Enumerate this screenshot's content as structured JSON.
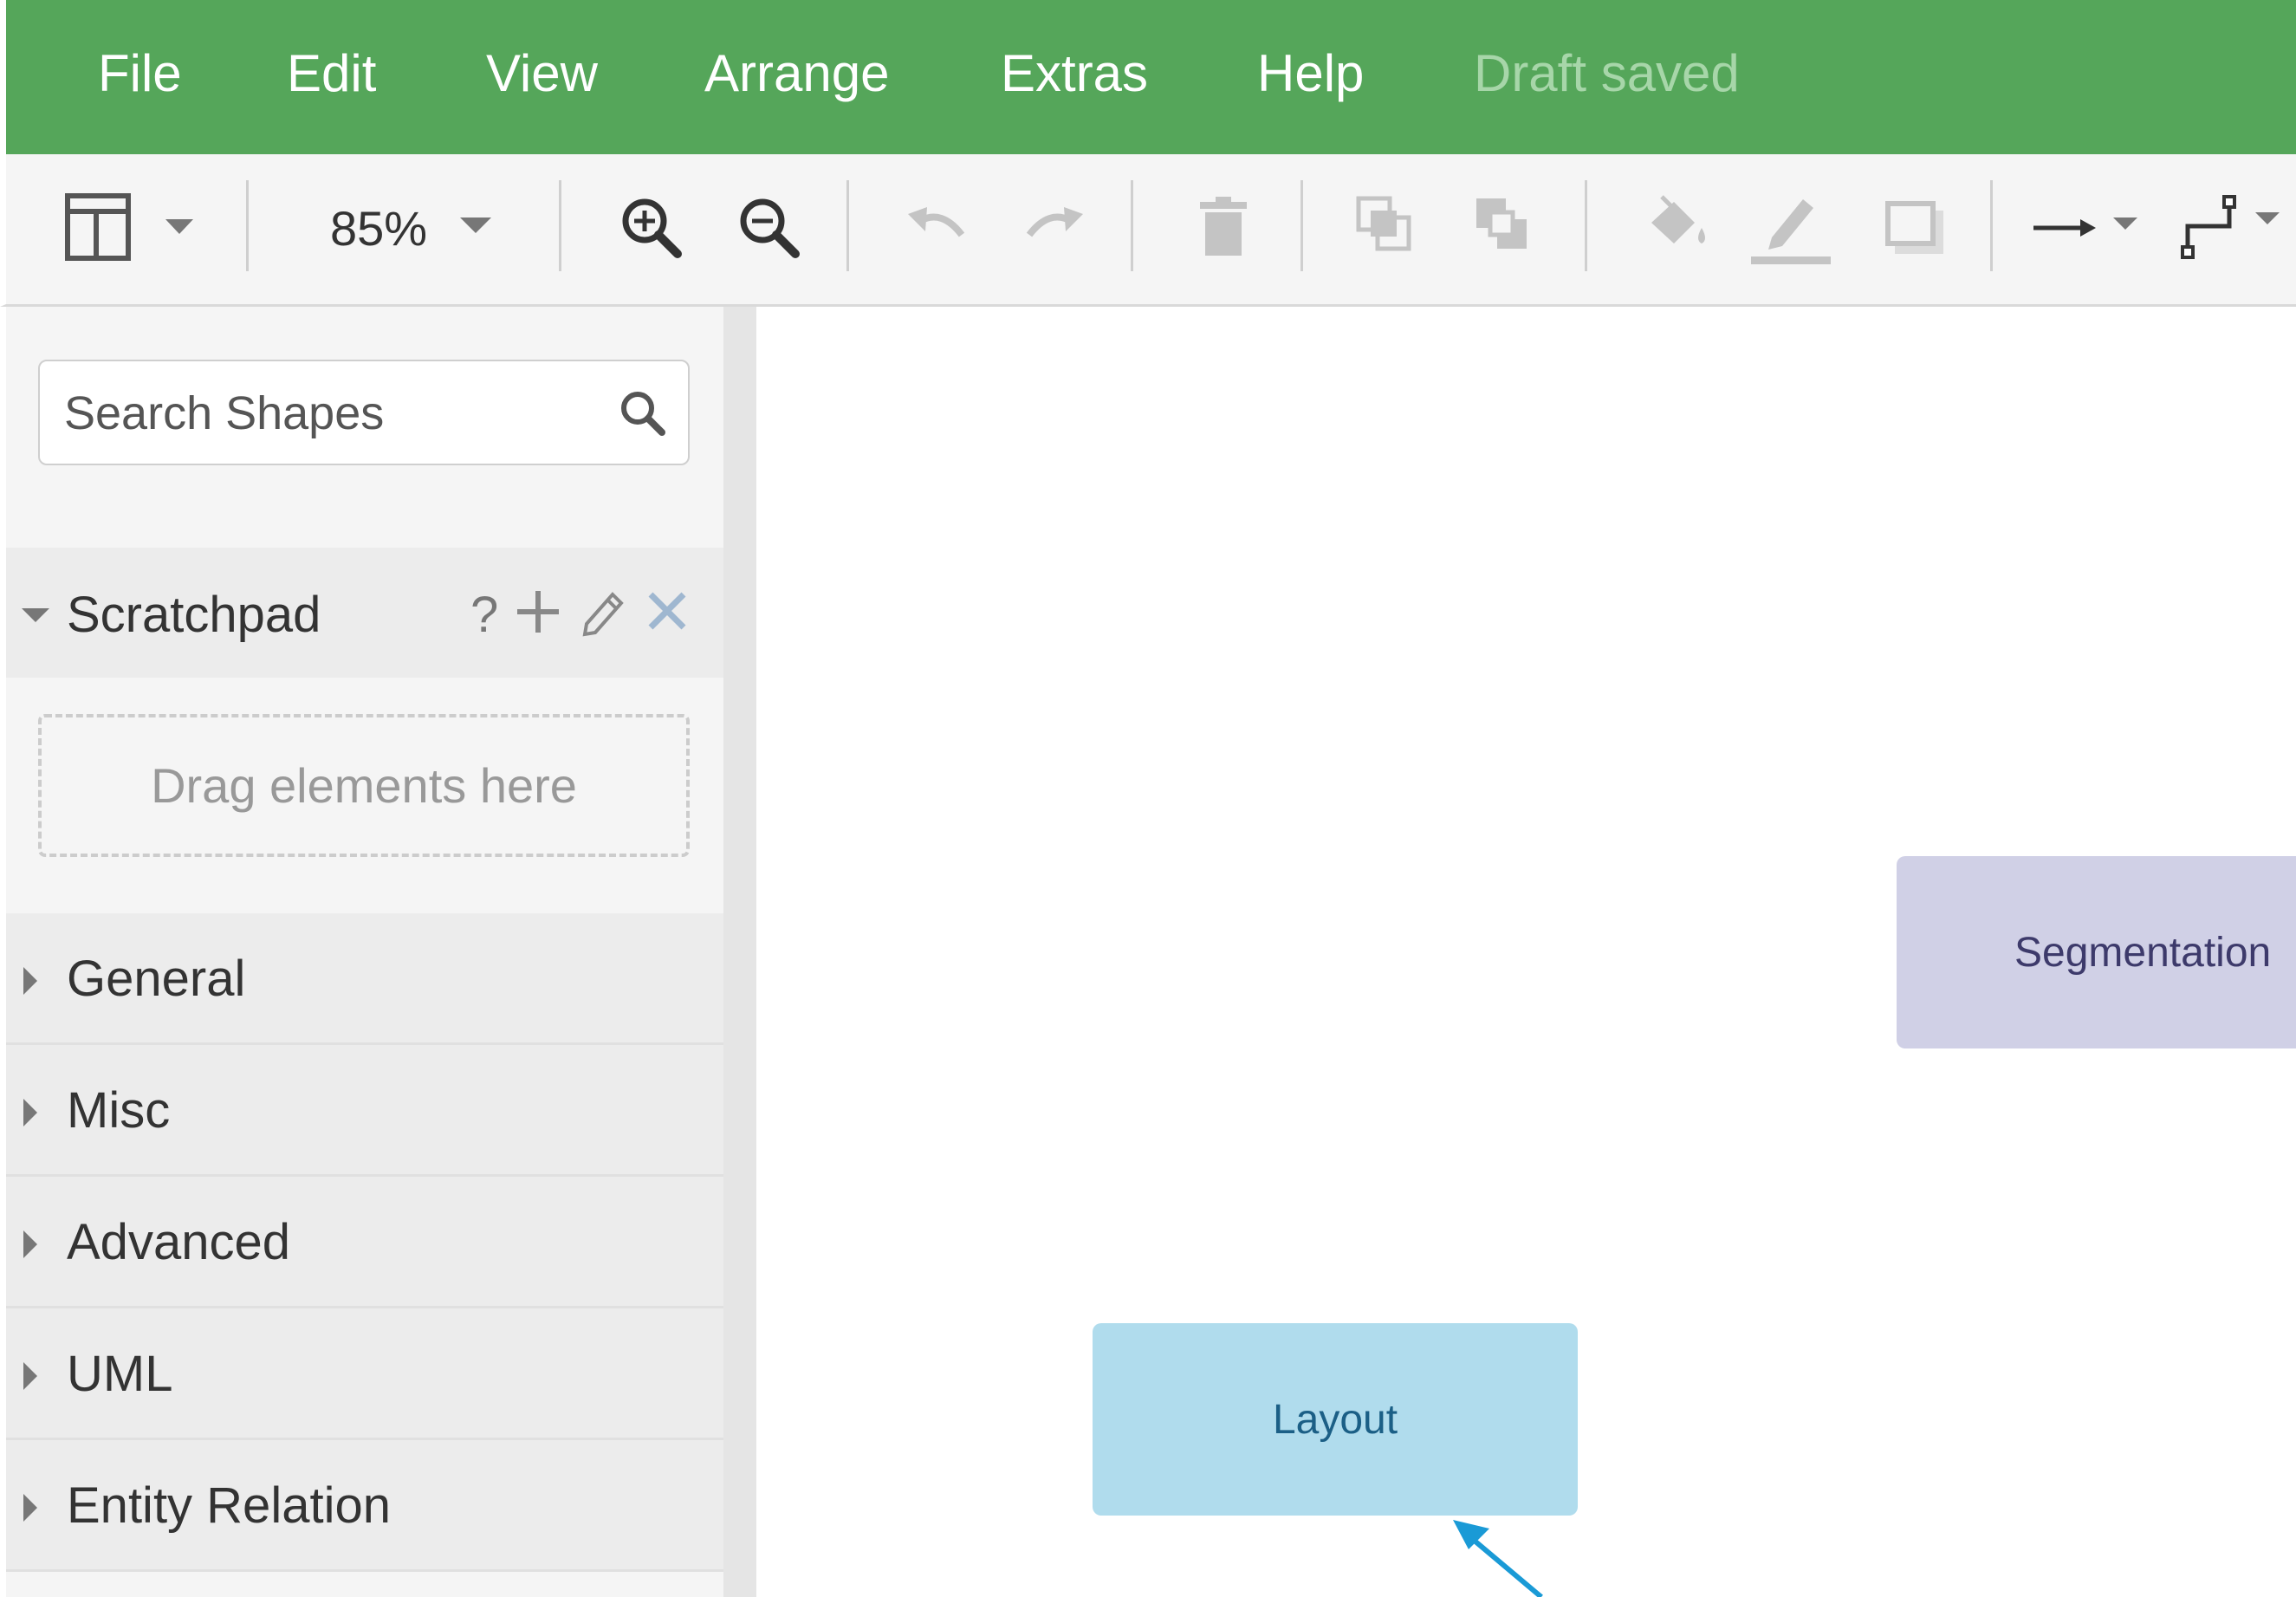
{
  "menubar": {
    "items": [
      "File",
      "Edit",
      "View",
      "Arrange",
      "Extras",
      "Help"
    ],
    "status": "Draft saved",
    "color": "#55a65a"
  },
  "toolbar": {
    "zoom": "85%",
    "icons": [
      "format-panel-icon",
      "zoom-in-icon",
      "zoom-out-icon",
      "undo-icon",
      "redo-icon",
      "delete-icon",
      "to-front-icon",
      "to-back-icon",
      "fill-color-icon",
      "line-color-icon",
      "shadow-icon",
      "connection-icon",
      "waypoints-icon"
    ]
  },
  "sidebar": {
    "search": {
      "placeholder": "Search Shapes"
    },
    "scratchpad": {
      "title": "Scratchpad",
      "help": "?",
      "drop_hint": "Drag elements here"
    },
    "palettes": [
      "General",
      "Misc",
      "Advanced",
      "UML",
      "Entity Relation"
    ]
  },
  "canvas": {
    "shapes": {
      "segmentation": {
        "label": "Segmentation",
        "fill": "#d0d0e6",
        "text_color": "#3d3a6b"
      },
      "layout": {
        "label": "Layout",
        "fill": "#b0dced",
        "text_color": "#1b5f86"
      }
    },
    "edge_color": "#1a9ad6"
  }
}
